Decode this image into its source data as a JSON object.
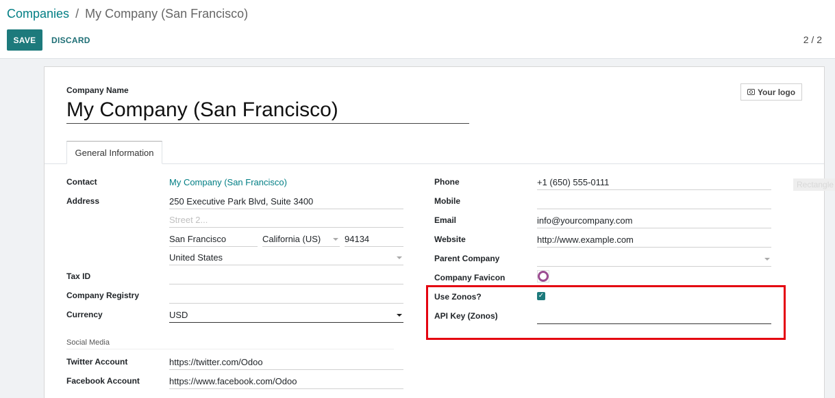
{
  "breadcrumb": {
    "parent": "Companies",
    "separator": "/",
    "current": "My Company (San Francisco)"
  },
  "toolbar": {
    "save_label": "SAVE",
    "discard_label": "DISCARD",
    "pager": "2 / 2"
  },
  "form": {
    "company_name_label": "Company Name",
    "company_name_value": "My Company (San Francisco)",
    "logo_button": "Your logo",
    "tabs": [
      {
        "label": "General Information"
      }
    ],
    "left": {
      "contact_label": "Contact",
      "contact_value": "My Company (San Francisco)",
      "address_label": "Address",
      "street": "250 Executive Park Blvd, Suite 3400",
      "street2_placeholder": "Street 2...",
      "city": "San Francisco",
      "state": "California (US)",
      "zip": "94134",
      "country": "United States",
      "tax_id_label": "Tax ID",
      "tax_id_value": "",
      "registry_label": "Company Registry",
      "registry_value": "",
      "currency_label": "Currency",
      "currency_value": "USD",
      "social_section": "Social Media",
      "twitter_label": "Twitter Account",
      "twitter_value": "https://twitter.com/Odoo",
      "facebook_label": "Facebook Account",
      "facebook_value": "https://www.facebook.com/Odoo"
    },
    "right": {
      "phone_label": "Phone",
      "phone_value": "+1 (650) 555-0111",
      "mobile_label": "Mobile",
      "mobile_value": "",
      "email_label": "Email",
      "email_value": "info@yourcompany.com",
      "website_label": "Website",
      "website_value": "http://www.example.com",
      "parent_company_label": "Parent Company",
      "parent_company_value": "",
      "favicon_label": "Company Favicon",
      "use_zonos_label": "Use Zonos?",
      "use_zonos_checked": true,
      "api_key_label": "API Key (Zonos)",
      "api_key_value": ""
    }
  },
  "annotation": {
    "ghost_label": "Rectangle",
    "highlight_color": "#e4000f"
  },
  "colors": {
    "primary": "#1d7a7c",
    "link": "#017e84",
    "favicon": "#9b4c91"
  }
}
